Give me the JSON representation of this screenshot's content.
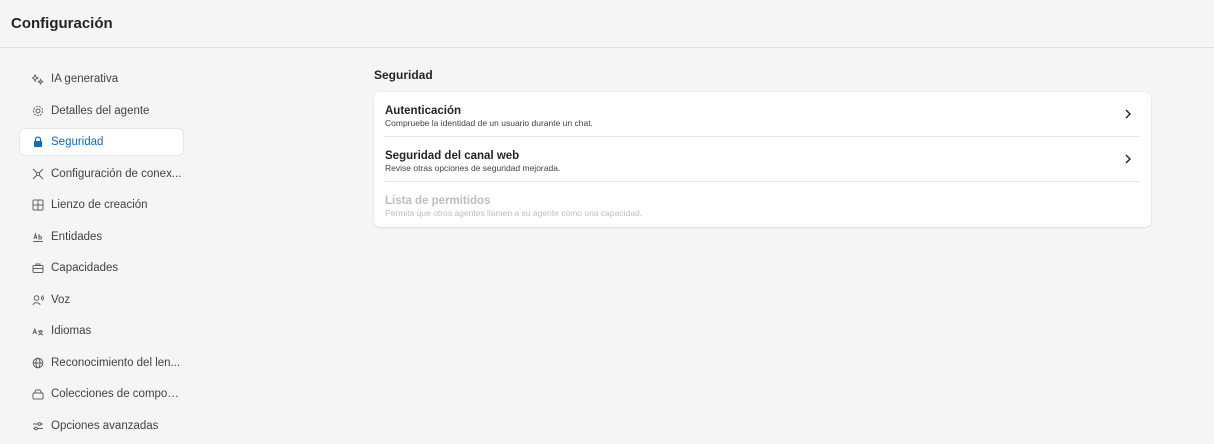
{
  "header": {
    "title": "Configuración"
  },
  "sidebar": {
    "items": [
      {
        "label": "IA generativa",
        "icon": "sparkle-icon",
        "active": false
      },
      {
        "label": "Detalles del agente",
        "icon": "gear-icon",
        "active": false
      },
      {
        "label": "Seguridad",
        "icon": "lock-icon",
        "active": true
      },
      {
        "label": "Configuración de conex...",
        "icon": "plug-icon",
        "active": false
      },
      {
        "label": "Lienzo de creación",
        "icon": "grid-icon",
        "active": false
      },
      {
        "label": "Entidades",
        "icon": "entity-icon",
        "active": false
      },
      {
        "label": "Capacidades",
        "icon": "briefcase-icon",
        "active": false
      },
      {
        "label": "Voz",
        "icon": "voice-icon",
        "active": false
      },
      {
        "label": "Idiomas",
        "icon": "translate-icon",
        "active": false
      },
      {
        "label": "Reconocimiento del len...",
        "icon": "globe-icon",
        "active": false
      },
      {
        "label": "Colecciones de compon...",
        "icon": "collection-icon",
        "active": false
      },
      {
        "label": "Opciones avanzadas",
        "icon": "sliders-icon",
        "active": false
      }
    ]
  },
  "main": {
    "section_title": "Seguridad",
    "rows": [
      {
        "title": "Autenticación",
        "description": "Compruebe la identidad de un usuario durante un chat.",
        "enabled": true
      },
      {
        "title": "Seguridad del canal web",
        "description": "Revise otras opciones de seguridad mejorada.",
        "enabled": true
      },
      {
        "title": "Lista de permitidos",
        "description": "Permita que otros agentes llamen a su agente como una capacidad.",
        "enabled": false
      }
    ]
  },
  "colors": {
    "accent": "#0f6cbd",
    "background": "#f5f5f5",
    "card": "#ffffff",
    "disabled_text": "#bdbdbd"
  }
}
